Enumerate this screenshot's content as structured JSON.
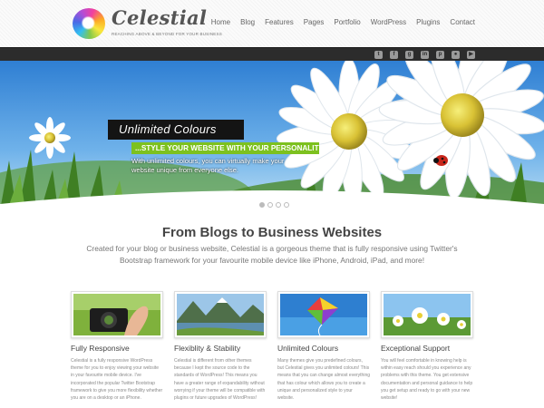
{
  "header": {
    "logo_title": "Celestial",
    "logo_tagline": "Reaching above & beyond for your business",
    "nav": [
      "Home",
      "Blog",
      "Features",
      "Pages",
      "Portfolio",
      "WordPress",
      "Plugins",
      "Contact"
    ]
  },
  "social_icons": [
    "twitter-icon",
    "facebook-icon",
    "google-plus-icon",
    "linkedin-icon",
    "pinterest-icon",
    "flickr-icon",
    "youtube-icon"
  ],
  "hero": {
    "caption_title": "Unlimited Colours",
    "caption_subtitle": "...STYLE YOUR WEBSITE WITH YOUR PERSONALITY!",
    "caption_text": "With unlimited colours, you can virtually make your website unique from everyone else.",
    "active_slide": 1,
    "slide_count": 4
  },
  "intro": {
    "title": "From Blogs to Business Websites",
    "text": "Created for your blog or business website, Celestial is a gorgeous theme that is fully responsive using Twitter's Bootstrap framework for your favourite mobile device like iPhone, Android, iPad, and more!"
  },
  "features": [
    {
      "title": "Fully Responsive",
      "text": "Celestial is a fully responsive WordPress theme for you to enjoy viewing your website in your favourite mobile device. I've incorporated the popular Twitter Bootstrap framework to give you more flexibility whether you are on a desktop or an iPhone."
    },
    {
      "title": "Flexiblity & Stability",
      "text": "Celestial is different from other themes because I kept the source code to the standards of WordPress! This means you have a greater range of expandability without worrying if your theme will be compatible with plugins or future upgrades of WordPress!"
    },
    {
      "title": "Unlimited Colours",
      "text": "Many themes give you predefined colours, but Celestial gives you unlimited colours! This means that you can change almost everything that has colour which allows you to create a unique and personalized style to your website."
    },
    {
      "title": "Exceptional Support",
      "text": "You will feel comfortable in knowing help is within easy reach should you experience any problems with this theme. You get extensive documentation and personal guidance to help you get setup and ready to go with your new website!"
    }
  ],
  "colors": {
    "accent_green": "#7dc11f",
    "caption_dark": "#141414",
    "social_bar": "#2c2c2c",
    "sky_blue": "#3f8fd6"
  }
}
